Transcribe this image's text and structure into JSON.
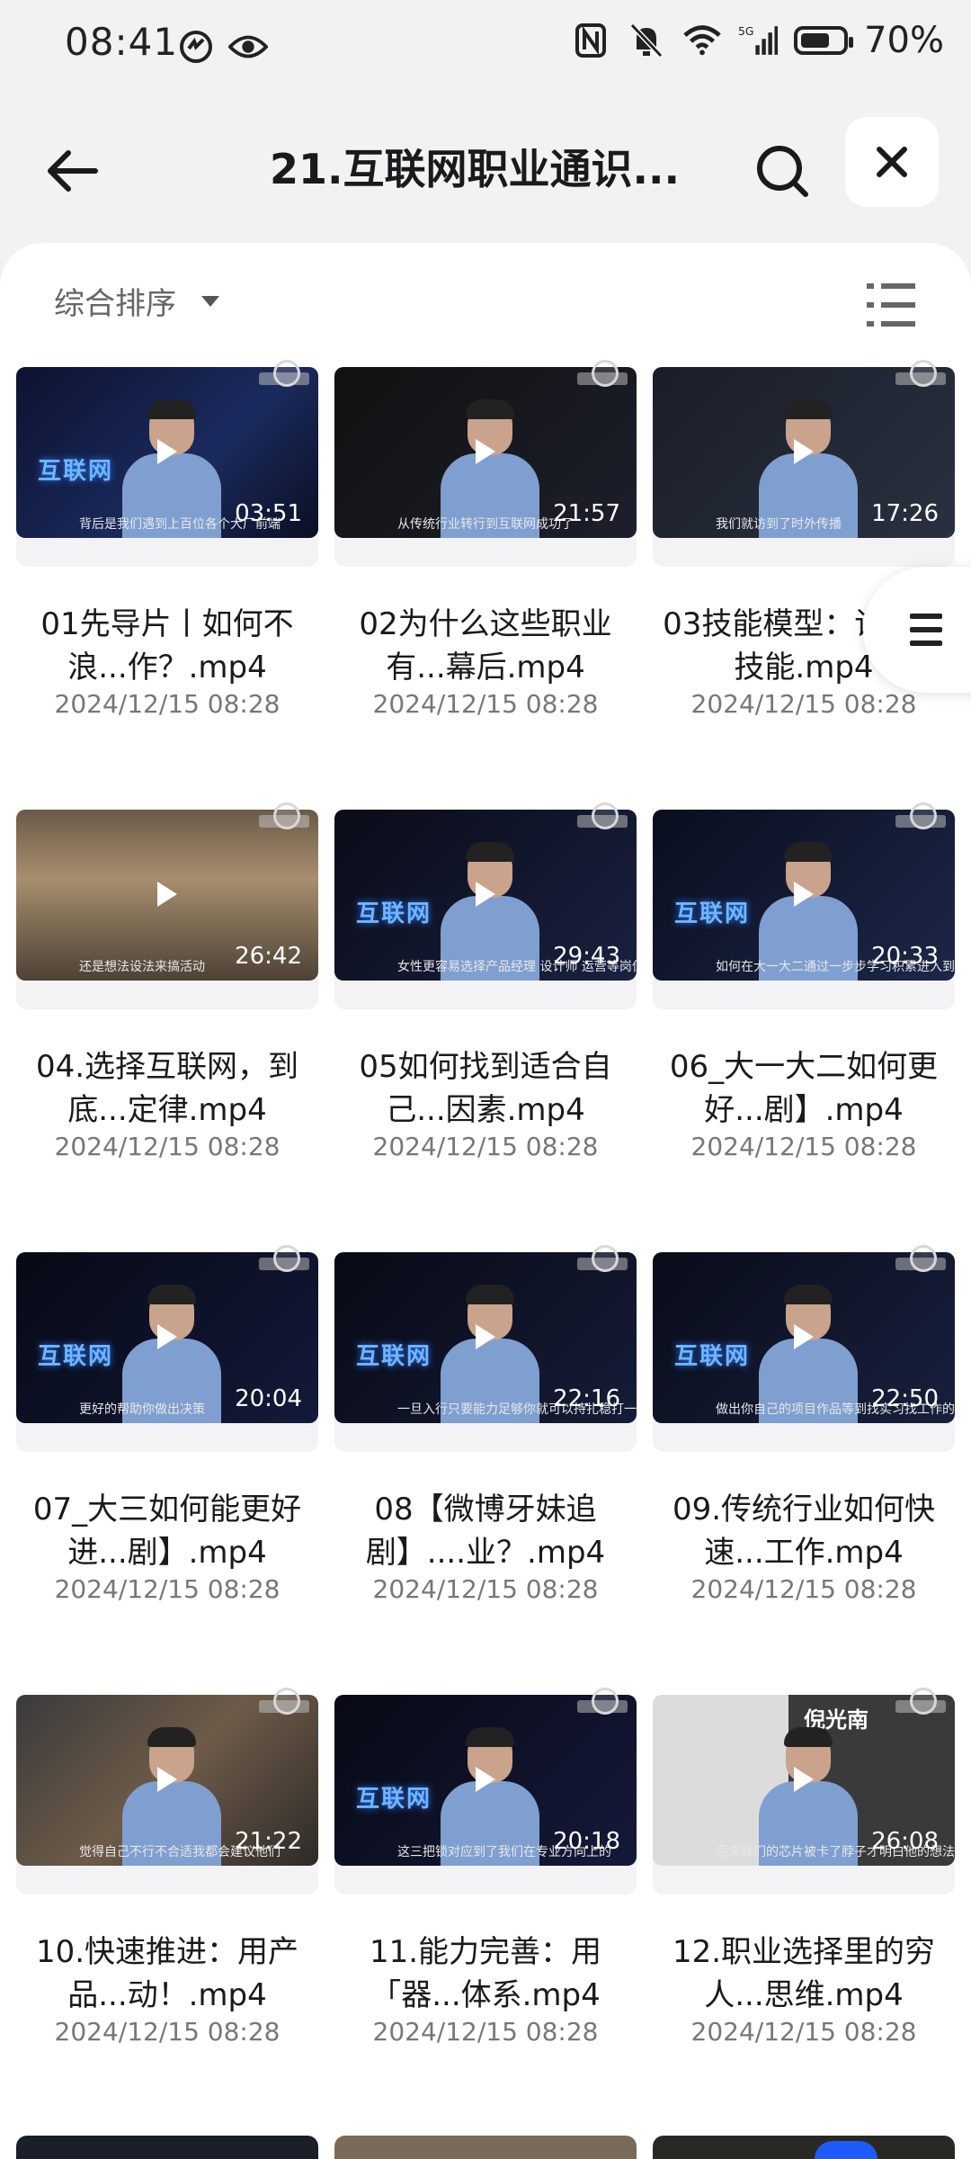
{
  "status_bar": {
    "time": "08:41",
    "network": "5G",
    "battery_text": "70%"
  },
  "header": {
    "title": "21.互联网职业通识...",
    "back_icon": "arrow-left-icon",
    "search_icon": "search-icon",
    "close_icon": "close-icon"
  },
  "toolbar": {
    "sort_label": "综合排序"
  },
  "videos": [
    {
      "name": "01先导片丨如何不浪...作？.mp4",
      "date": "2024/12/15 08:28",
      "duration": "03:51"
    },
    {
      "name": "02为什么这些职业有...幕后.mp4",
      "date": "2024/12/15 08:28",
      "duration": "21:57"
    },
    {
      "name": "03技能模型：论什...技能.mp4",
      "date": "2024/12/15 08:28",
      "duration": "17:26"
    },
    {
      "name": "04.选择互联网，到底...定律.mp4",
      "date": "2024/12/15 08:28",
      "duration": "26:42"
    },
    {
      "name": "05如何找到适合自己...因素.mp4",
      "date": "2024/12/15 08:28",
      "duration": "29:43"
    },
    {
      "name": "06_大一大二如何更好...剧】.mp4",
      "date": "2024/12/15 08:28",
      "duration": "20:33"
    },
    {
      "name": "07_大三如何能更好进...剧】.mp4",
      "date": "2024/12/15 08:28",
      "duration": "20:04"
    },
    {
      "name": "08【微博牙妹追剧】....业？.mp4",
      "date": "2024/12/15 08:28",
      "duration": "22:16"
    },
    {
      "name": "09.传统行业如何快速...工作.mp4",
      "date": "2024/12/15 08:28",
      "duration": "22:50"
    },
    {
      "name": "10.快速推进：用产品...动！.mp4",
      "date": "2024/12/15 08:28",
      "duration": "21:22"
    },
    {
      "name": "11.能力完善：用「器...体系.mp4",
      "date": "2024/12/15 08:28",
      "duration": "20:18"
    },
    {
      "name": "12.职业选择里的穷人...思维.mp4",
      "date": "2024/12/15 08:28",
      "duration": "26:08"
    }
  ],
  "thumbnails": {
    "overlay_text": "互联网",
    "subtitles": [
      "背后是我们遇到上百位各个大厂前端",
      "从传统行业转行到互联网成功了",
      "我们就访到了时外传播",
      "还是想法设法来搞活动",
      "女性更容易选择产品经理 设计师 运营等岗位",
      "如何在大一大二通过一步步学习积累进入到互联网行业",
      "更好的帮助你做出决策",
      "一旦入行只要能力足够你就可以持扎稳打一步一步",
      "做出你自己的项目作品等到找实习找工作的时候",
      "觉得自己不行不合适我都会建议他们",
      "这三把锁对应到了我们在专业方向上的",
      "后来我们的芯片被卡了脖子才明白他的想法"
    ],
    "name_caption": "倪光南"
  },
  "colors": {
    "accent": "#1a1a1a",
    "sheet": "#ffffff",
    "background": "#f2f2f4",
    "muted": "#777777"
  }
}
